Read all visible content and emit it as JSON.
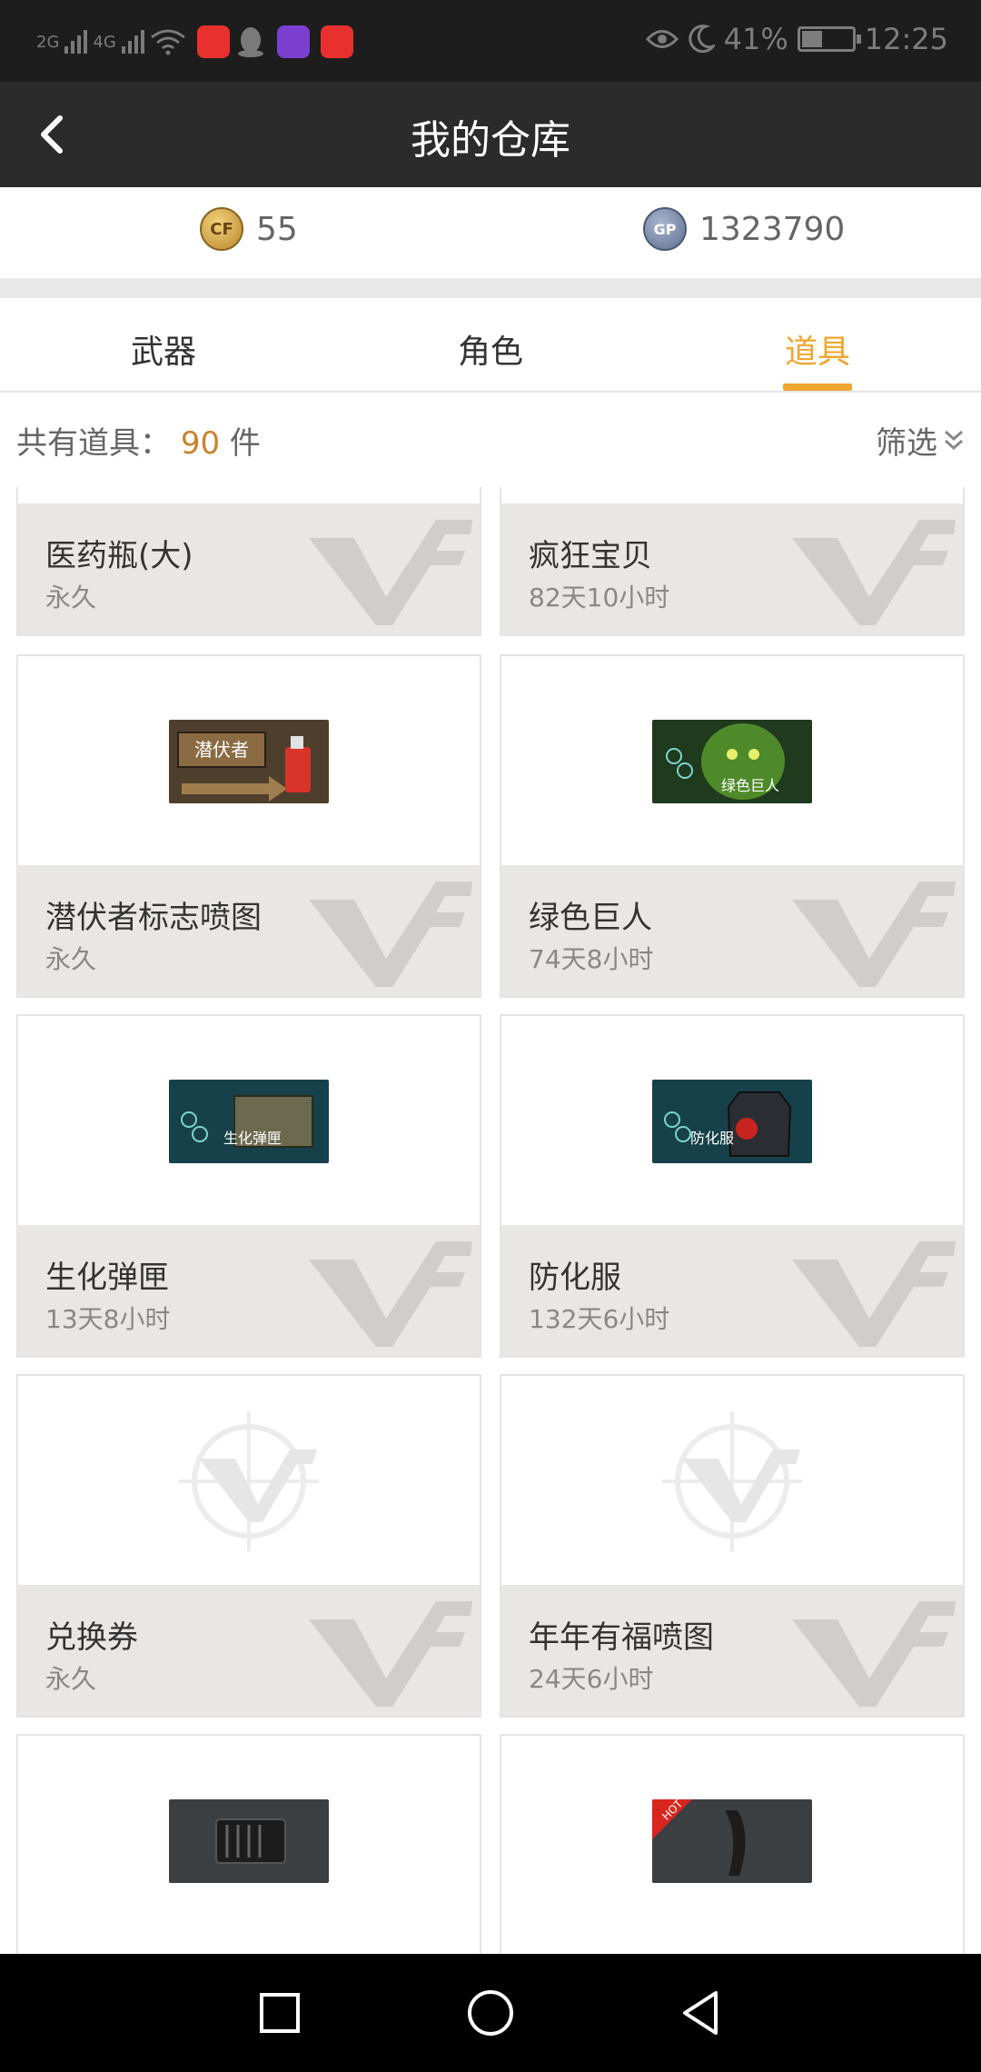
{
  "status_bar": {
    "signal1": "2G",
    "signal2": "4G",
    "battery_pct": "41%",
    "time": "12:25",
    "battery_level": 0.41,
    "icons": [
      "signal-icon",
      "signal-icon",
      "wifi-icon",
      "app-icon-red",
      "qq-icon",
      "video-app-icon",
      "app-icon-red2",
      "eye-icon",
      "moon-icon",
      "battery-icon"
    ]
  },
  "header": {
    "title": "我的仓库"
  },
  "currency": {
    "cf_points": "55",
    "gp": "1323790",
    "gp_label": "GP"
  },
  "tabs": [
    {
      "label": "武器",
      "active": false
    },
    {
      "label": "角色",
      "active": false
    },
    {
      "label": "道具",
      "active": true
    }
  ],
  "summary": {
    "prefix": "共有道具：",
    "count": "90",
    "unit": "件",
    "filter_label": "筛选"
  },
  "items": [
    {
      "name": "医药瓶(大)",
      "duration": "永久",
      "image": "partial",
      "thumb_label": ""
    },
    {
      "name": "疯狂宝贝",
      "duration": "82天10小时",
      "image": "partial",
      "thumb_label": ""
    },
    {
      "name": "潜伏者标志喷图",
      "duration": "永久",
      "image": "spray-sign",
      "thumb_label": "潜伏者"
    },
    {
      "name": "绿色巨人",
      "duration": "74天8小时",
      "image": "green-giant",
      "thumb_label": "绿色巨人"
    },
    {
      "name": "生化弹匣",
      "duration": "13天8小时",
      "image": "bio-ammo",
      "thumb_label": "生化弹匣"
    },
    {
      "name": "防化服",
      "duration": "132天6小时",
      "image": "hazmat",
      "thumb_label": "防化服"
    },
    {
      "name": "兑换券",
      "duration": "永久",
      "image": "placeholder",
      "thumb_label": ""
    },
    {
      "name": "年年有福喷图",
      "duration": "24天6小时",
      "image": "placeholder",
      "thumb_label": ""
    },
    {
      "name": "",
      "duration": "",
      "image": "magazine",
      "thumb_label": ""
    },
    {
      "name": "",
      "duration": "",
      "image": "magazine-hot",
      "thumb_label": "HOT"
    }
  ],
  "colors": {
    "accent": "#f0a630",
    "header_bg": "#2b2b2b",
    "status_bg": "#1d1d1d",
    "card_info_bg": "#e9e7e5"
  }
}
